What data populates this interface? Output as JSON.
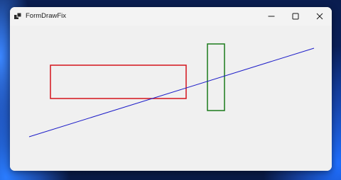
{
  "window": {
    "title": "FormDrawFix",
    "icons": {
      "app": "app-window-icon",
      "minimize": "minimize-icon",
      "maximize": "maximize-icon",
      "close": "close-icon"
    }
  },
  "drawing": {
    "line_color": "#1c1cc8",
    "red_rect_color": "#d4131b",
    "green_rect_color": "#1a7a1a"
  }
}
